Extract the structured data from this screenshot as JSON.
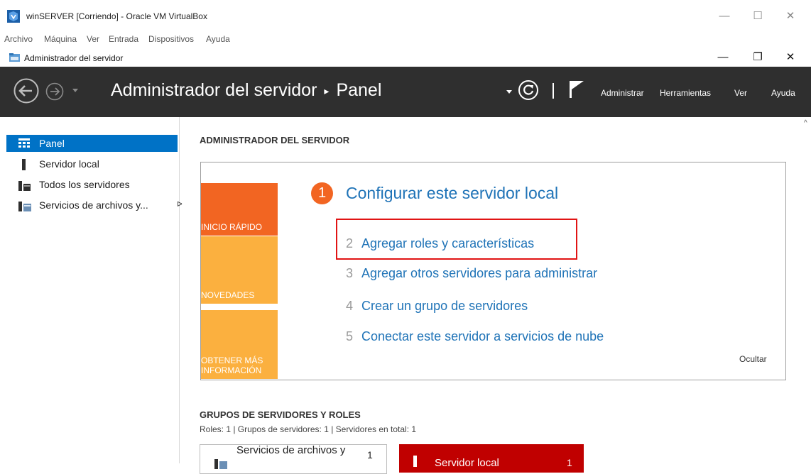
{
  "vbox": {
    "title": "winSERVER [Corriendo] - Oracle VM VirtualBox",
    "menu": [
      "Archivo",
      "Máquina",
      "Ver",
      "Entrada",
      "Dispositivos",
      "Ayuda"
    ],
    "min": "—",
    "max": "☐",
    "close": "✕"
  },
  "inner": {
    "title": "Administrador del servidor",
    "min": "—",
    "max": "❐",
    "close": "✕"
  },
  "header": {
    "app": "Administrador del servidor",
    "page": "Panel",
    "sep": "▸",
    "menu": [
      "Administrar",
      "Herramientas",
      "Ver",
      "Ayuda"
    ]
  },
  "sidebar": {
    "items": [
      {
        "label": "Panel",
        "icon": "dashboard-icon"
      },
      {
        "label": "Servidor local",
        "icon": "server-icon"
      },
      {
        "label": "Todos los servidores",
        "icon": "servers-icon"
      },
      {
        "label": "Servicios de archivos y...",
        "icon": "file-services-icon",
        "arrow": "ᐅ"
      }
    ]
  },
  "main": {
    "heading": "ADMINISTRADOR DEL SERVIDOR",
    "tiles": [
      "INICIO RÁPIDO",
      "NOVEDADES",
      "OBTENER MÁS INFORMACIÓN"
    ],
    "step1": {
      "num": "1",
      "title": "Configurar este servidor local"
    },
    "steps": [
      {
        "num": "2",
        "label": "Agregar roles y características"
      },
      {
        "num": "3",
        "label": "Agregar otros servidores para administrar"
      },
      {
        "num": "4",
        "label": "Crear un grupo de servidores"
      },
      {
        "num": "5",
        "label": "Conectar este servidor a servicios de nube"
      }
    ],
    "hide": "Ocultar",
    "groups_heading": "GRUPOS DE SERVIDORES Y ROLES",
    "groups_sub": "Roles: 1   |   Grupos de servidores: 1   |   Servidores en total: 1",
    "card1": {
      "label": "Servicios de archivos y",
      "count": "1"
    },
    "card2": {
      "label": "Servidor local",
      "count": "1"
    }
  },
  "colors": {
    "accent": "#0072c6",
    "orange": "#f26522",
    "tile_light": "#fbb03f",
    "header": "#2f2f2f",
    "link": "#1f73b7",
    "highlight": "#e11414",
    "card_red": "#c00000"
  }
}
